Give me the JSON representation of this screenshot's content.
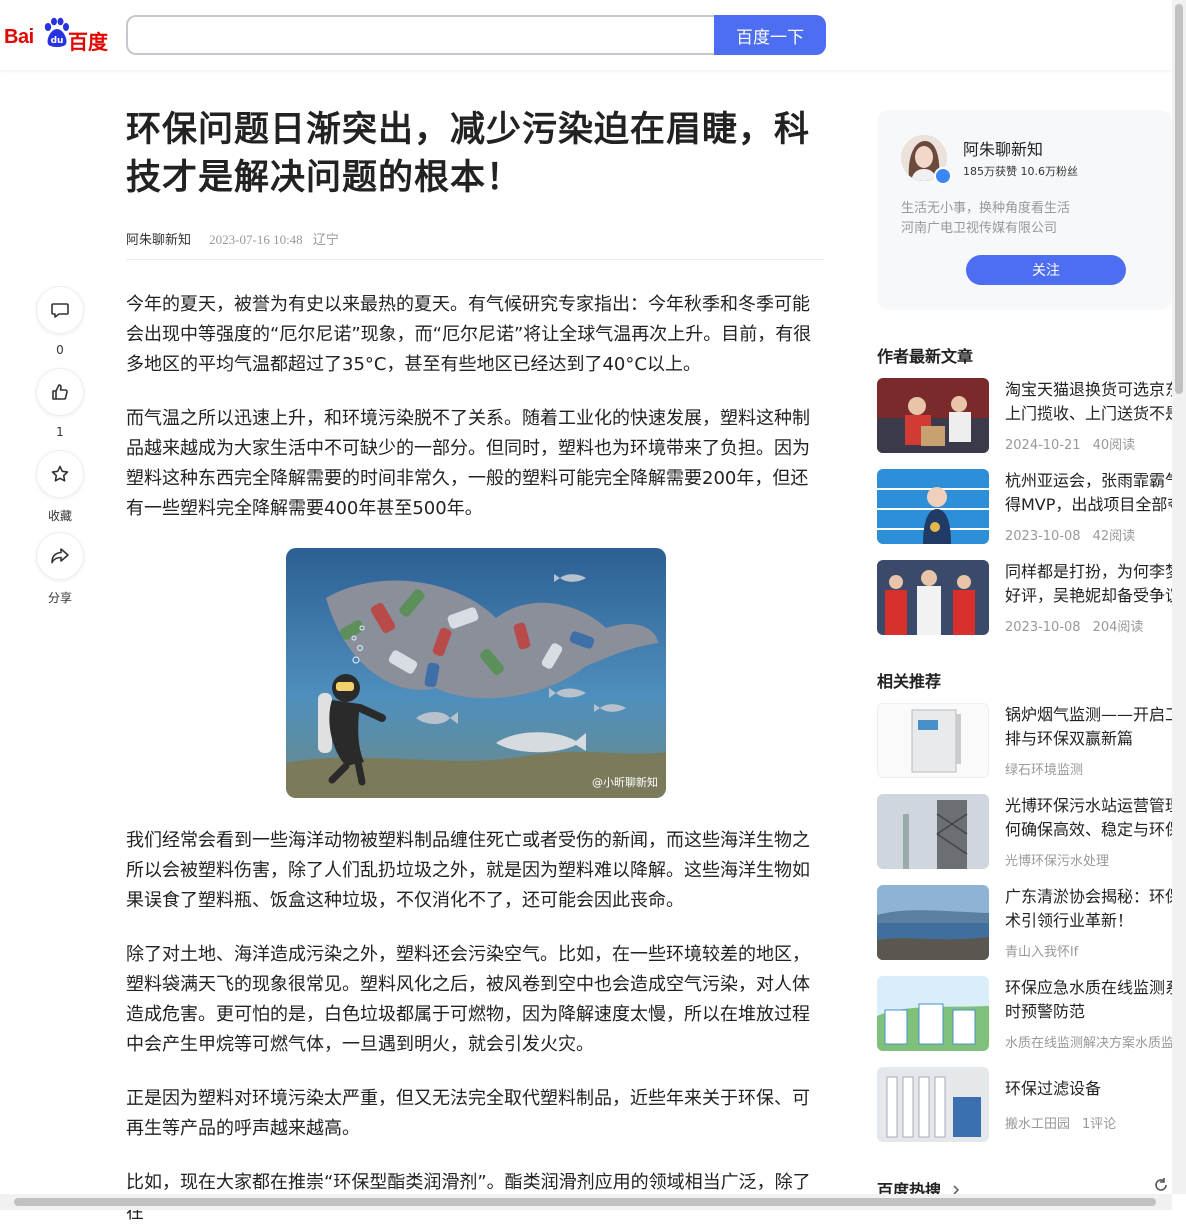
{
  "header": {
    "logo_text_latin": "Bai",
    "logo_text_cn": "百度",
    "search_value": "",
    "search_button": "百度一下"
  },
  "rail": {
    "comment_count": "0",
    "like_count": "1",
    "collect_label": "收藏",
    "share_label": "分享"
  },
  "article": {
    "title": "环保问题日渐突出，减少污染迫在眉睫，科技才是解决问题的根本！",
    "author": "阿朱聊新知",
    "time": "2023-07-16 10:48",
    "location": "辽宁",
    "paragraphs": [
      "今年的夏天，被誉为有史以来最热的夏天。有气候研究专家指出：今年秋季和冬季可能会出现中等强度的“厄尔尼诺”现象，而“厄尔尼诺”将让全球气温再次上升。目前，有很多地区的平均气温都超过了35°C，甚至有些地区已经达到了40°C以上。",
      "而气温之所以迅速上升，和环境污染脱不了关系。随着工业化的快速发展，塑料这种制品越来越成为大家生活中不可缺少的一部分。但同时，塑料也为环境带来了负担。因为塑料这种东西完全降解需要的时间非常久，一般的塑料可能完全降解需要200年，但还有一些塑料完全降解需要400年甚至500年。",
      "我们经常会看到一些海洋动物被塑料制品缠住死亡或者受伤的新闻，而这些海洋生物之所以会被塑料伤害，除了人们乱扔垃圾之外，就是因为塑料难以降解。这些海洋生物如果误食了塑料瓶、饭盒这种垃圾，不仅消化不了，还可能会因此丧命。",
      "除了对土地、海洋造成污染之外，塑料还会污染空气。比如，在一些环境较差的地区，塑料袋满天飞的现象很常见。塑料风化之后，被风卷到空中也会造成空气污染，对人体造成危害。更可怕的是，白色垃圾都属于可燃物，因为降解速度太慢，所以在堆放过程中会产生甲烷等可燃气体，一旦遇到明火，就会引发火灾。",
      "正是因为塑料对环境污染太严重，但又无法完全取代塑料制品，近些年来关于环保、可再生等产品的呼声越来越高。",
      "比如，现在大家都在推崇“环保型酯类润滑剂”。酯类润滑剂应用的领域相当广泛，除了在"
    ],
    "image_watermark": "@小昕聊新知"
  },
  "author_card": {
    "name": "阿朱聊新知",
    "stats": "185万获赞 10.6万粉丝",
    "desc1": "生活无小事，换种角度看生活",
    "desc2": "河南广电卫视传媒有限公司",
    "follow": "关注"
  },
  "latest": {
    "heading": "作者最新文章",
    "items": [
      {
        "line1": "淘宝天猫退换货可选京东",
        "line2": "上门揽收、上门送货不是",
        "date": "2024-10-21",
        "reads": "40阅读"
      },
      {
        "line1": "杭州亚运会，张雨霏霸气",
        "line2": "得MVP，出战项目全部夺",
        "date": "2023-10-08",
        "reads": "42阅读"
      },
      {
        "line1": "同样都是打扮，为何李梦",
        "line2": "好评，吴艳妮却备受争议",
        "date": "2023-10-08",
        "reads": "204阅读"
      }
    ]
  },
  "related": {
    "heading": "相关推荐",
    "items": [
      {
        "line1": "锅炉烟气监测——开启工",
        "line2": "排与环保双赢新篇",
        "source": "绿石环境监测"
      },
      {
        "line1": "光博环保污水站运营管理",
        "line2": "何确保高效、稳定与环保",
        "source": "光博环保污水处理"
      },
      {
        "line1": "广东清淤协会揭秘：环保",
        "line2": "术引领行业革新！",
        "source": "青山入我怀lf"
      },
      {
        "line1": "环保应急水质在线监测系",
        "line2": "时预警防范",
        "source": "水质在线监测解决方案水质监"
      },
      {
        "line1": "环保过滤设备",
        "line2": "",
        "source": "搬水工田园",
        "comments": "1评论"
      }
    ]
  },
  "hot": {
    "heading": "百度热搜"
  }
}
